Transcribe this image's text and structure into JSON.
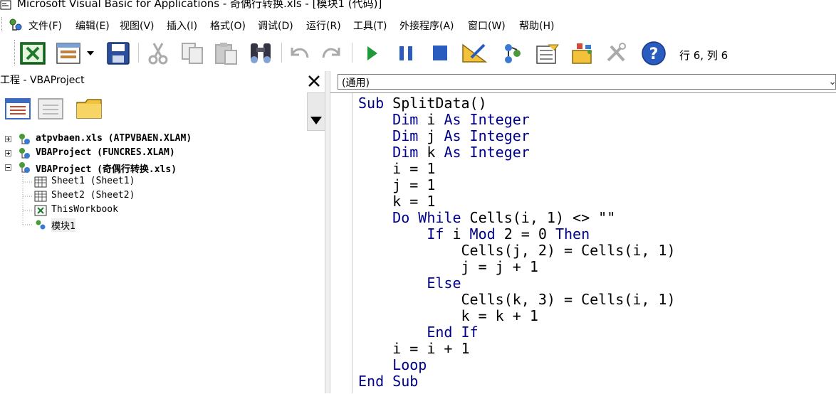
{
  "window": {
    "title": "Microsoft Visual Basic for Applications - 奇偶行转换.xls - [模块1 (代码)]"
  },
  "menu": [
    "文件(F)",
    "编辑(E)",
    "视图(V)",
    "插入(I)",
    "格式(O)",
    "调试(D)",
    "运行(R)",
    "工具(T)",
    "外接程序(A)",
    "窗口(W)",
    "帮助(H)"
  ],
  "toolbar": {
    "status": "行 6, 列 6"
  },
  "project_explorer": {
    "title": "工程 - VBAProject",
    "tree": [
      {
        "label": "atpvbaen.xls (ATPVBAEN.XLAM)",
        "bold": true
      },
      {
        "label": "VBAProject (FUNCRES.XLAM)",
        "bold": true
      },
      {
        "label": "VBAProject (奇偶行转换.xls)",
        "bold": true
      },
      {
        "label": "Sheet1 (Sheet1)"
      },
      {
        "label": "Sheet2 (Sheet2)"
      },
      {
        "label": "ThisWorkbook"
      },
      {
        "label": "模块1"
      }
    ]
  },
  "code_window": {
    "object_combo": "(通用)",
    "lines": [
      [
        {
          "t": "Sub ",
          "k": 1
        },
        {
          "t": "SplitData()"
        }
      ],
      [
        {
          "t": "    "
        },
        {
          "t": "Dim ",
          "k": 1
        },
        {
          "t": "i "
        },
        {
          "t": "As Integer",
          "k": 1
        }
      ],
      [
        {
          "t": "    "
        },
        {
          "t": "Dim ",
          "k": 1
        },
        {
          "t": "j "
        },
        {
          "t": "As Integer",
          "k": 1
        }
      ],
      [
        {
          "t": "    "
        },
        {
          "t": "Dim ",
          "k": 1
        },
        {
          "t": "k "
        },
        {
          "t": "As Integer",
          "k": 1
        }
      ],
      [
        {
          "t": "    i = 1"
        }
      ],
      [
        {
          "t": "    j = 1"
        }
      ],
      [
        {
          "t": "    k = 1"
        }
      ],
      [
        {
          "t": "    "
        },
        {
          "t": "Do While ",
          "k": 1
        },
        {
          "t": "Cells(i, 1) <> \"\""
        }
      ],
      [
        {
          "t": "        "
        },
        {
          "t": "If ",
          "k": 1
        },
        {
          "t": "i "
        },
        {
          "t": "Mod ",
          "k": 1
        },
        {
          "t": "2 = 0 "
        },
        {
          "t": "Then",
          "k": 1
        }
      ],
      [
        {
          "t": "            Cells(j, 2) = Cells(i, 1)"
        }
      ],
      [
        {
          "t": "            j = j + 1"
        }
      ],
      [
        {
          "t": "        "
        },
        {
          "t": "Else",
          "k": 1
        }
      ],
      [
        {
          "t": "            Cells(k, 3) = Cells(i, 1)"
        }
      ],
      [
        {
          "t": "            k = k + 1"
        }
      ],
      [
        {
          "t": "        "
        },
        {
          "t": "End If",
          "k": 1
        }
      ],
      [
        {
          "t": "    i = i + 1"
        }
      ],
      [
        {
          "t": "    "
        },
        {
          "t": "Loop",
          "k": 1
        }
      ],
      [
        {
          "t": "End Sub",
          "k": 1
        }
      ]
    ]
  }
}
